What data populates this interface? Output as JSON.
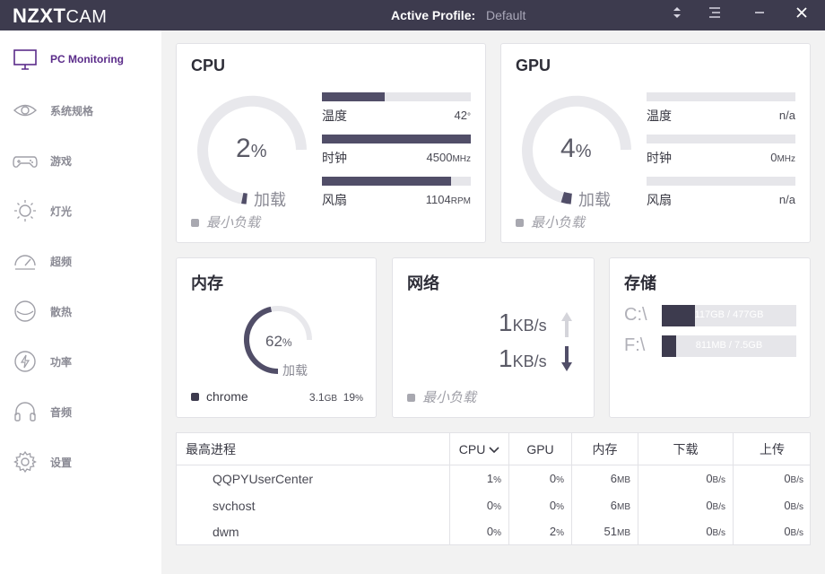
{
  "titlebar": {
    "logo_main": "NZXT",
    "logo_sub": "CAM",
    "profile_label": "Active Profile:",
    "profile_value": "Default"
  },
  "sidebar": {
    "items": [
      {
        "label": "PC Monitoring",
        "icon": "monitor-icon"
      },
      {
        "label": "系统规格",
        "icon": "eye-icon"
      },
      {
        "label": "游戏",
        "icon": "gamepad-icon"
      },
      {
        "label": "灯光",
        "icon": "sun-icon"
      },
      {
        "label": "超频",
        "icon": "speedometer-icon"
      },
      {
        "label": "散热",
        "icon": "cooling-icon"
      },
      {
        "label": "功率",
        "icon": "bolt-icon"
      },
      {
        "label": "音频",
        "icon": "headphones-icon"
      },
      {
        "label": "设置",
        "icon": "gear-icon"
      }
    ]
  },
  "cpu": {
    "title": "CPU",
    "load_value": "2",
    "load_unit": "%",
    "load_label": "加载",
    "min_load": "最小负载",
    "stats": [
      {
        "name": "温度",
        "value": "42",
        "unit": "°",
        "fill": 0.42
      },
      {
        "name": "时钟",
        "value": "4500",
        "unit": "MHz",
        "fill": 1.0
      },
      {
        "name": "风扇",
        "value": "1104",
        "unit": "RPM",
        "fill": 0.87
      }
    ]
  },
  "gpu": {
    "title": "GPU",
    "load_value": "4",
    "load_unit": "%",
    "load_label": "加载",
    "min_load": "最小负载",
    "stats": [
      {
        "name": "温度",
        "value": "n/a",
        "unit": "",
        "fill": 0
      },
      {
        "name": "时钟",
        "value": "0",
        "unit": "MHz",
        "fill": 0
      },
      {
        "name": "风扇",
        "value": "n/a",
        "unit": "",
        "fill": 0
      }
    ]
  },
  "memory": {
    "title": "内存",
    "value": "62",
    "unit": "%",
    "load_label": "加载",
    "fill": 0.62,
    "process": "chrome",
    "process_size": "3.1",
    "process_size_unit": "GB",
    "process_pct": "19",
    "process_pct_unit": "%"
  },
  "network": {
    "title": "网络",
    "up_value": "1",
    "up_unit": "KB/s",
    "down_value": "1",
    "down_unit": "KB/s",
    "min_load": "最小负载"
  },
  "storage": {
    "title": "存储",
    "drives": [
      {
        "letter": "C:\\",
        "text": "117GB / 477GB",
        "fill": 0.245
      },
      {
        "letter": "F:\\",
        "text": "811MB / 7.5GB",
        "fill": 0.105
      }
    ]
  },
  "processes": {
    "headers": [
      "最高进程",
      "CPU",
      "GPU",
      "内存",
      "下载",
      "上传"
    ],
    "rows": [
      {
        "name": "QQPYUserCenter",
        "cpu": "1",
        "gpu": "0",
        "mem": "6",
        "down": "0",
        "up": "0"
      },
      {
        "name": "svchost",
        "cpu": "0",
        "gpu": "0",
        "mem": "6",
        "down": "0",
        "up": "0"
      },
      {
        "name": "dwm",
        "cpu": "0",
        "gpu": "2",
        "mem": "51",
        "down": "0",
        "up": "0"
      }
    ],
    "units": {
      "pct": "%",
      "mem": "MB",
      "rate": "B/s"
    }
  },
  "colors": {
    "titlebar": "#3d3b4e",
    "accent": "#5b2c8a",
    "bar_fill": "#514e68",
    "bar_bg": "#e6e6ea"
  }
}
